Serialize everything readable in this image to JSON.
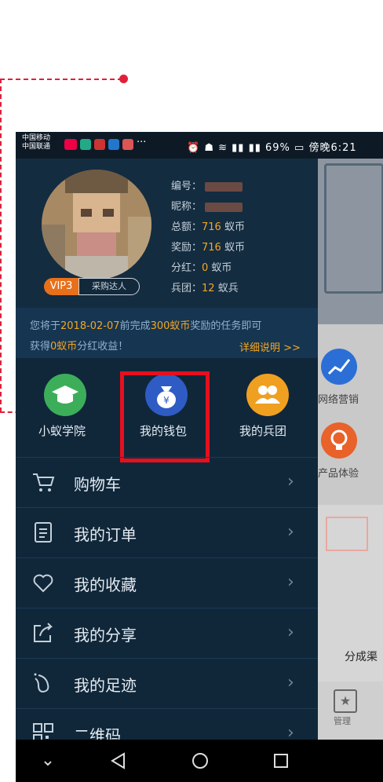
{
  "status_bar": {
    "carrier_1": "中国移动",
    "carrier_2": "中国联通",
    "right_text": "⏰ ☗ ≋ ▮▮ ▮▮ 69% ▭ 傍晚6:21"
  },
  "profile": {
    "vip_badge": "VIP3",
    "vip_title": "采购达人",
    "rows": [
      {
        "label": "编号：",
        "value": ""
      },
      {
        "label": "昵称：",
        "value": ""
      },
      {
        "label": "总额：",
        "value": "716",
        "unit": " 蚁币"
      },
      {
        "label": "奖励：",
        "value": "716",
        "unit": " 蚁币"
      },
      {
        "label": "分红：",
        "value": "0",
        "unit": " 蚁币"
      },
      {
        "label": "兵团：",
        "value": "12",
        "unit": " 蚁兵"
      }
    ]
  },
  "notice": {
    "prefix": "您将于",
    "date": "2018-02-07",
    "mid": "前完成",
    "amount": "300蚁币",
    "suffix": "奖励的任务即可",
    "line2_prefix": "获得",
    "line2_amount": "0蚁币",
    "line2_suffix": "分红收益！",
    "more": "详细说明 >>"
  },
  "quick_actions": [
    {
      "label": "小蚁学院",
      "icon": "graduation-cap-icon",
      "color": "#3cae5a"
    },
    {
      "label": "我的钱包",
      "icon": "money-bag-icon",
      "color": "#2f5bc4"
    },
    {
      "label": "我的兵团",
      "icon": "group-icon",
      "color": "#f0a020"
    }
  ],
  "menu": [
    {
      "label": "购物车",
      "icon": "shopping-cart-icon"
    },
    {
      "label": "我的订单",
      "icon": "order-list-icon"
    },
    {
      "label": "我的收藏",
      "icon": "heart-icon"
    },
    {
      "label": "我的分享",
      "icon": "share-icon"
    },
    {
      "label": "我的足迹",
      "icon": "footprint-icon"
    },
    {
      "label": "二维码",
      "icon": "qr-code-icon"
    }
  ],
  "background_page": {
    "item1": "网络营销",
    "item2": "产品体验",
    "item3": "分成渠",
    "item4": "管理"
  },
  "colors": {
    "annotation": "#e0203a",
    "highlight_box": "#e5101e",
    "accent": "#f5a623"
  }
}
